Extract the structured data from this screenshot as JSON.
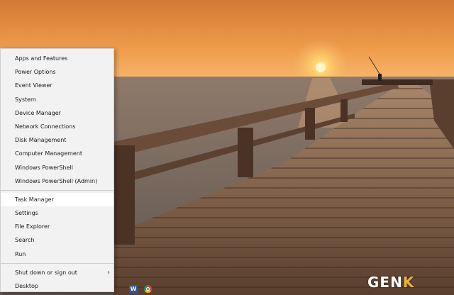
{
  "power_menu": {
    "group1": [
      {
        "label": "Apps and Features"
      },
      {
        "label": "Power Options"
      },
      {
        "label": "Event Viewer"
      },
      {
        "label": "System"
      },
      {
        "label": "Device Manager"
      },
      {
        "label": "Network Connections"
      },
      {
        "label": "Disk Management"
      },
      {
        "label": "Computer Management"
      },
      {
        "label": "Windows PowerShell"
      },
      {
        "label": "Windows PowerShell (Admin)"
      }
    ],
    "group2": [
      {
        "label": "Task Manager"
      },
      {
        "label": "Settings"
      },
      {
        "label": "File Explorer"
      },
      {
        "label": "Search"
      },
      {
        "label": "Run"
      }
    ],
    "group3": [
      {
        "label": "Shut down or sign out"
      },
      {
        "label": "Desktop"
      }
    ],
    "hovered_item": "Task Manager"
  },
  "taskbar": {
    "word_icon_letter": "W"
  },
  "watermark": {
    "text_main": "GEN",
    "text_accent": "K"
  },
  "colors": {
    "menu_bg": "#f2f2f2",
    "menu_hover": "#ffffff",
    "sky_top": "#e08a3c",
    "sun": "#ffd36a",
    "pier": "#5b4232"
  }
}
